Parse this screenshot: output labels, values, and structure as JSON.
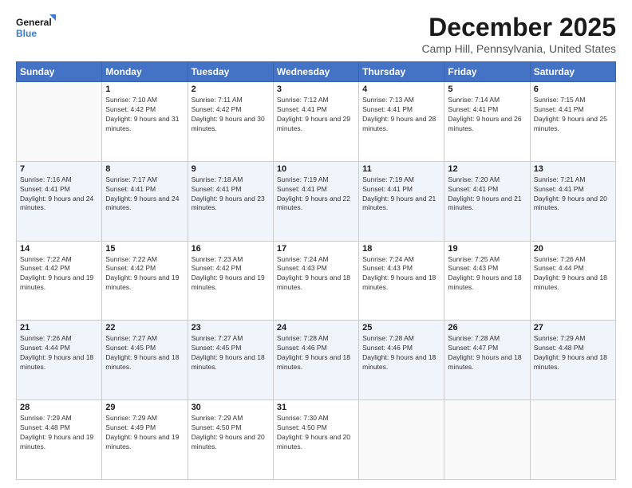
{
  "logo": {
    "line1": "General",
    "line2": "Blue"
  },
  "title": "December 2025",
  "subtitle": "Camp Hill, Pennsylvania, United States",
  "days_header": [
    "Sunday",
    "Monday",
    "Tuesday",
    "Wednesday",
    "Thursday",
    "Friday",
    "Saturday"
  ],
  "weeks": [
    [
      {
        "day": "",
        "sunrise": "",
        "sunset": "",
        "daylight": ""
      },
      {
        "day": "1",
        "sunrise": "Sunrise: 7:10 AM",
        "sunset": "Sunset: 4:42 PM",
        "daylight": "Daylight: 9 hours and 31 minutes."
      },
      {
        "day": "2",
        "sunrise": "Sunrise: 7:11 AM",
        "sunset": "Sunset: 4:42 PM",
        "daylight": "Daylight: 9 hours and 30 minutes."
      },
      {
        "day": "3",
        "sunrise": "Sunrise: 7:12 AM",
        "sunset": "Sunset: 4:41 PM",
        "daylight": "Daylight: 9 hours and 29 minutes."
      },
      {
        "day": "4",
        "sunrise": "Sunrise: 7:13 AM",
        "sunset": "Sunset: 4:41 PM",
        "daylight": "Daylight: 9 hours and 28 minutes."
      },
      {
        "day": "5",
        "sunrise": "Sunrise: 7:14 AM",
        "sunset": "Sunset: 4:41 PM",
        "daylight": "Daylight: 9 hours and 26 minutes."
      },
      {
        "day": "6",
        "sunrise": "Sunrise: 7:15 AM",
        "sunset": "Sunset: 4:41 PM",
        "daylight": "Daylight: 9 hours and 25 minutes."
      }
    ],
    [
      {
        "day": "7",
        "sunrise": "Sunrise: 7:16 AM",
        "sunset": "Sunset: 4:41 PM",
        "daylight": "Daylight: 9 hours and 24 minutes."
      },
      {
        "day": "8",
        "sunrise": "Sunrise: 7:17 AM",
        "sunset": "Sunset: 4:41 PM",
        "daylight": "Daylight: 9 hours and 24 minutes."
      },
      {
        "day": "9",
        "sunrise": "Sunrise: 7:18 AM",
        "sunset": "Sunset: 4:41 PM",
        "daylight": "Daylight: 9 hours and 23 minutes."
      },
      {
        "day": "10",
        "sunrise": "Sunrise: 7:19 AM",
        "sunset": "Sunset: 4:41 PM",
        "daylight": "Daylight: 9 hours and 22 minutes."
      },
      {
        "day": "11",
        "sunrise": "Sunrise: 7:19 AM",
        "sunset": "Sunset: 4:41 PM",
        "daylight": "Daylight: 9 hours and 21 minutes."
      },
      {
        "day": "12",
        "sunrise": "Sunrise: 7:20 AM",
        "sunset": "Sunset: 4:41 PM",
        "daylight": "Daylight: 9 hours and 21 minutes."
      },
      {
        "day": "13",
        "sunrise": "Sunrise: 7:21 AM",
        "sunset": "Sunset: 4:41 PM",
        "daylight": "Daylight: 9 hours and 20 minutes."
      }
    ],
    [
      {
        "day": "14",
        "sunrise": "Sunrise: 7:22 AM",
        "sunset": "Sunset: 4:42 PM",
        "daylight": "Daylight: 9 hours and 19 minutes."
      },
      {
        "day": "15",
        "sunrise": "Sunrise: 7:22 AM",
        "sunset": "Sunset: 4:42 PM",
        "daylight": "Daylight: 9 hours and 19 minutes."
      },
      {
        "day": "16",
        "sunrise": "Sunrise: 7:23 AM",
        "sunset": "Sunset: 4:42 PM",
        "daylight": "Daylight: 9 hours and 19 minutes."
      },
      {
        "day": "17",
        "sunrise": "Sunrise: 7:24 AM",
        "sunset": "Sunset: 4:43 PM",
        "daylight": "Daylight: 9 hours and 18 minutes."
      },
      {
        "day": "18",
        "sunrise": "Sunrise: 7:24 AM",
        "sunset": "Sunset: 4:43 PM",
        "daylight": "Daylight: 9 hours and 18 minutes."
      },
      {
        "day": "19",
        "sunrise": "Sunrise: 7:25 AM",
        "sunset": "Sunset: 4:43 PM",
        "daylight": "Daylight: 9 hours and 18 minutes."
      },
      {
        "day": "20",
        "sunrise": "Sunrise: 7:26 AM",
        "sunset": "Sunset: 4:44 PM",
        "daylight": "Daylight: 9 hours and 18 minutes."
      }
    ],
    [
      {
        "day": "21",
        "sunrise": "Sunrise: 7:26 AM",
        "sunset": "Sunset: 4:44 PM",
        "daylight": "Daylight: 9 hours and 18 minutes."
      },
      {
        "day": "22",
        "sunrise": "Sunrise: 7:27 AM",
        "sunset": "Sunset: 4:45 PM",
        "daylight": "Daylight: 9 hours and 18 minutes."
      },
      {
        "day": "23",
        "sunrise": "Sunrise: 7:27 AM",
        "sunset": "Sunset: 4:45 PM",
        "daylight": "Daylight: 9 hours and 18 minutes."
      },
      {
        "day": "24",
        "sunrise": "Sunrise: 7:28 AM",
        "sunset": "Sunset: 4:46 PM",
        "daylight": "Daylight: 9 hours and 18 minutes."
      },
      {
        "day": "25",
        "sunrise": "Sunrise: 7:28 AM",
        "sunset": "Sunset: 4:46 PM",
        "daylight": "Daylight: 9 hours and 18 minutes."
      },
      {
        "day": "26",
        "sunrise": "Sunrise: 7:28 AM",
        "sunset": "Sunset: 4:47 PM",
        "daylight": "Daylight: 9 hours and 18 minutes."
      },
      {
        "day": "27",
        "sunrise": "Sunrise: 7:29 AM",
        "sunset": "Sunset: 4:48 PM",
        "daylight": "Daylight: 9 hours and 18 minutes."
      }
    ],
    [
      {
        "day": "28",
        "sunrise": "Sunrise: 7:29 AM",
        "sunset": "Sunset: 4:48 PM",
        "daylight": "Daylight: 9 hours and 19 minutes."
      },
      {
        "day": "29",
        "sunrise": "Sunrise: 7:29 AM",
        "sunset": "Sunset: 4:49 PM",
        "daylight": "Daylight: 9 hours and 19 minutes."
      },
      {
        "day": "30",
        "sunrise": "Sunrise: 7:29 AM",
        "sunset": "Sunset: 4:50 PM",
        "daylight": "Daylight: 9 hours and 20 minutes."
      },
      {
        "day": "31",
        "sunrise": "Sunrise: 7:30 AM",
        "sunset": "Sunset: 4:50 PM",
        "daylight": "Daylight: 9 hours and 20 minutes."
      },
      {
        "day": "",
        "sunrise": "",
        "sunset": "",
        "daylight": ""
      },
      {
        "day": "",
        "sunrise": "",
        "sunset": "",
        "daylight": ""
      },
      {
        "day": "",
        "sunrise": "",
        "sunset": "",
        "daylight": ""
      }
    ]
  ]
}
